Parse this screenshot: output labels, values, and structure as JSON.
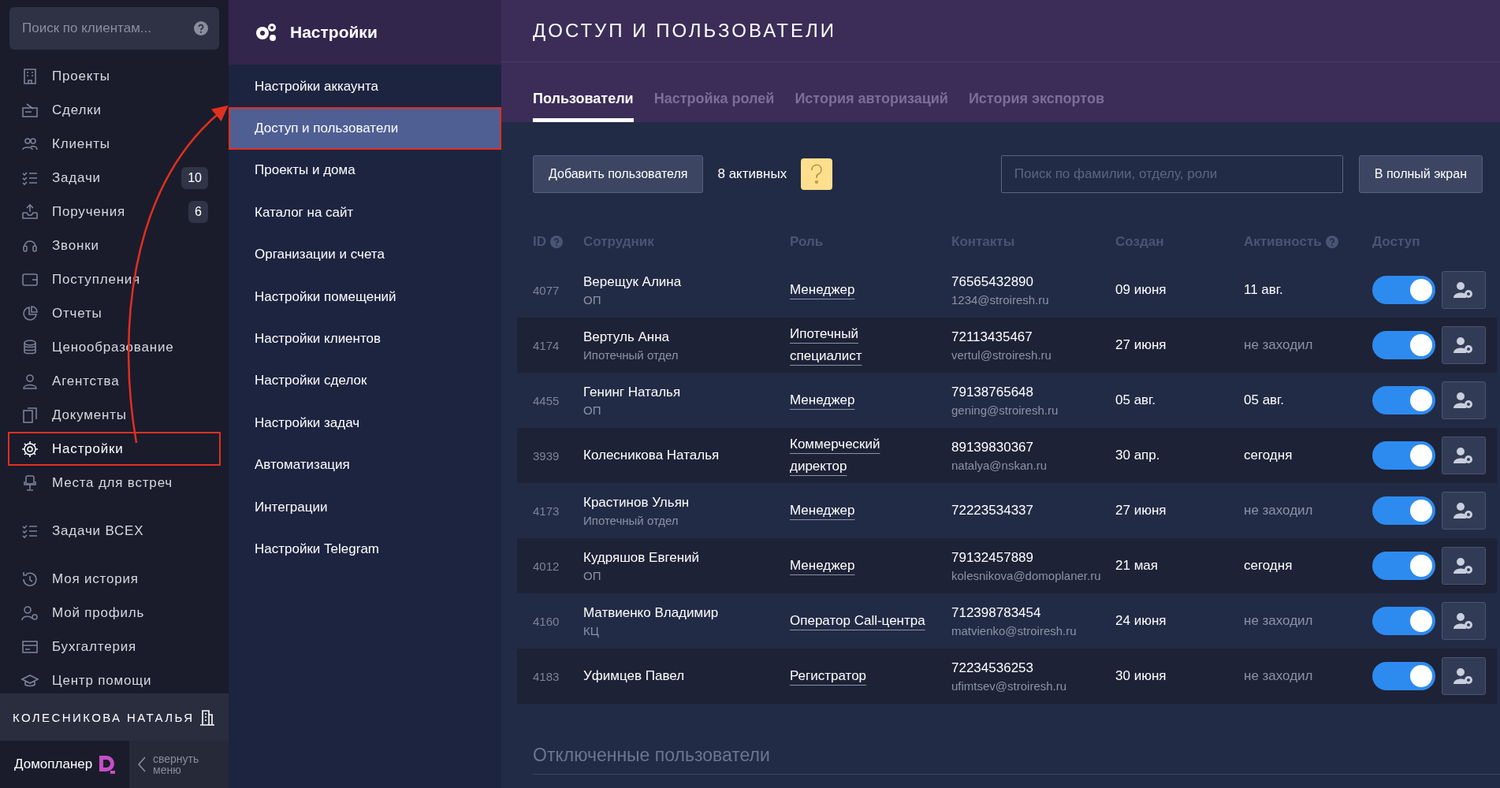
{
  "sidebar": {
    "search": {
      "placeholder": "Поиск по клиентам..."
    },
    "groups": [
      {
        "items": [
          {
            "label": "Проекты",
            "selected": false,
            "annotated": false
          },
          {
            "label": "Сделки",
            "selected": false,
            "annotated": false
          },
          {
            "label": "Клиенты",
            "selected": false,
            "annotated": false
          },
          {
            "label": "Задачи",
            "badge": "10",
            "selected": false,
            "annotated": false
          },
          {
            "label": "Поручения",
            "badge": "6",
            "selected": false,
            "annotated": false
          },
          {
            "label": "Звонки",
            "selected": false,
            "annotated": false
          },
          {
            "label": "Поступления",
            "selected": false,
            "annotated": false
          },
          {
            "label": "Отчеты",
            "selected": false,
            "annotated": false
          },
          {
            "label": "Ценообразование",
            "selected": false,
            "annotated": false
          },
          {
            "label": "Агентства",
            "selected": false,
            "annotated": false
          },
          {
            "label": "Документы",
            "selected": false,
            "annotated": false
          },
          {
            "label": "Настройки",
            "selected": true,
            "annotated": true
          },
          {
            "label": "Места для встреч",
            "selected": false,
            "annotated": false
          }
        ]
      },
      {
        "items": [
          {
            "label": "Задачи ВСЕХ",
            "selected": false,
            "annotated": false
          }
        ]
      },
      {
        "items": [
          {
            "label": "Моя история",
            "selected": false,
            "annotated": false
          },
          {
            "label": "Мой профиль",
            "selected": false,
            "annotated": false
          },
          {
            "label": "Бухгалтерия",
            "selected": false,
            "annotated": false
          },
          {
            "label": "Центр помощи",
            "selected": false,
            "annotated": false
          }
        ]
      }
    ],
    "user": "КОЛЕСНИКОВА НАТАЛЬЯ",
    "brand": "Домопланер",
    "collapse": "свернуть меню"
  },
  "settings_menu": {
    "title": "Настройки",
    "items": [
      {
        "label": "Настройки аккаунта",
        "selected": false,
        "annotated": false
      },
      {
        "label": "Доступ и пользователи",
        "selected": true,
        "annotated": true
      },
      {
        "label": "Проекты и дома",
        "selected": false,
        "annotated": false
      },
      {
        "label": "Каталог на сайт",
        "selected": false,
        "annotated": false
      },
      {
        "label": "Организации и счета",
        "selected": false,
        "annotated": false
      },
      {
        "label": "Настройки помещений",
        "selected": false,
        "annotated": false
      },
      {
        "label": "Настройки клиентов",
        "selected": false,
        "annotated": false
      },
      {
        "label": "Настройки сделок",
        "selected": false,
        "annotated": false
      },
      {
        "label": "Настройки задач",
        "selected": false,
        "annotated": false
      },
      {
        "label": "Автоматизация",
        "selected": false,
        "annotated": false
      },
      {
        "label": "Интеграции",
        "selected": false,
        "annotated": false
      },
      {
        "label": "Настройки Telegram",
        "selected": false,
        "annotated": false
      }
    ]
  },
  "page": {
    "title": "ДОСТУП И ПОЛЬЗОВАТЕЛИ",
    "tabs": [
      {
        "label": "Пользователи",
        "selected": true
      },
      {
        "label": "Настройка ролей",
        "selected": false
      },
      {
        "label": "История авторизаций",
        "selected": false
      },
      {
        "label": "История экспортов",
        "selected": false
      }
    ],
    "add_button": "Добавить пользователя",
    "active_count": "8 активных",
    "search": {
      "placeholder": "Поиск по фамилии, отделу, роли"
    },
    "fullscreen_button": "В полный экран",
    "table": {
      "columns": [
        "ID",
        "Сотрудник",
        "Роль",
        "Контакты",
        "Создан",
        "Активность",
        "Доступ"
      ],
      "rows": [
        {
          "id": "4077",
          "name": "Верещук Алина",
          "dept": "ОП",
          "role": "Менеджер",
          "phone": "76565432890",
          "email": "1234@stroiresh.ru",
          "created": "09 июня",
          "activity": "11 авг.",
          "visited": true,
          "access": true
        },
        {
          "id": "4174",
          "name": "Вертуль Анна",
          "dept": "Ипотечный отдел",
          "role": "Ипотечный специалист",
          "phone": "72113435467",
          "email": "vertul@stroiresh.ru",
          "created": "27 июня",
          "activity": "не заходил",
          "visited": false,
          "access": true
        },
        {
          "id": "4455",
          "name": "Генинг Наталья",
          "dept": "ОП",
          "role": "Менеджер",
          "phone": "79138765648",
          "email": "gening@stroiresh.ru",
          "created": "05 авг.",
          "activity": "05 авг.",
          "visited": true,
          "access": true
        },
        {
          "id": "3939",
          "name": "Колесникова Наталья",
          "role": "Коммерческий директор",
          "phone": "89139830367",
          "email": "natalya@nskan.ru",
          "created": "30 апр.",
          "activity": "сегодня",
          "visited": true,
          "access": true
        },
        {
          "id": "4173",
          "name": "Крастинов Ульян",
          "dept": "Ипотечный отдел",
          "role": "Менеджер",
          "phone": "72223534337",
          "created": "27 июня",
          "activity": "не заходил",
          "visited": false,
          "access": true
        },
        {
          "id": "4012",
          "name": "Кудряшов Евгений",
          "dept": "ОП",
          "role": "Менеджер",
          "phone": "79132457889",
          "email": "kolesnikova@domoplaner.ru",
          "created": "21 мая",
          "activity": "сегодня",
          "visited": true,
          "access": true
        },
        {
          "id": "4160",
          "name": "Матвиенко Владимир",
          "dept": "КЦ",
          "role": "Оператор Call-центра",
          "phone": "712398783454",
          "email": "matvienko@stroiresh.ru",
          "created": "24 июня",
          "activity": "не заходил",
          "visited": false,
          "access": true
        },
        {
          "id": "4183",
          "name": "Уфимцев Павел",
          "role": "Регистратор",
          "phone": "72234536253",
          "email": "ufimtsev@stroiresh.ru",
          "created": "30 июня",
          "activity": "не заходил",
          "visited": false,
          "access": true
        }
      ]
    },
    "disabled_title": "Отключенные пользователи"
  }
}
